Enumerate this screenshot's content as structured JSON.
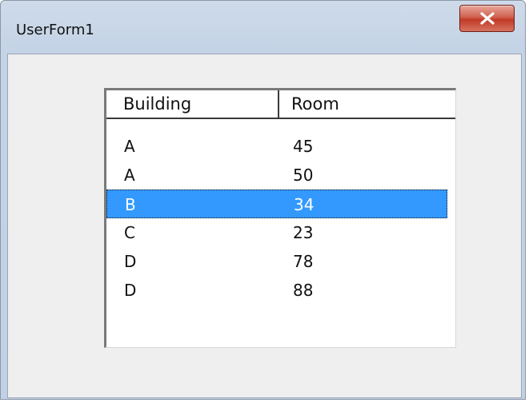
{
  "window": {
    "title": "UserForm1"
  },
  "listbox": {
    "columns": [
      "Building",
      "Room"
    ],
    "rows": [
      {
        "building": "A",
        "room": "45",
        "selected": false
      },
      {
        "building": "A",
        "room": "50",
        "selected": false
      },
      {
        "building": "B",
        "room": "34",
        "selected": true
      },
      {
        "building": "C",
        "room": "23",
        "selected": false
      },
      {
        "building": "D",
        "room": "78",
        "selected": false
      },
      {
        "building": "D",
        "room": "88",
        "selected": false
      }
    ],
    "selection_color": "#3399ff"
  },
  "icons": {
    "close": "close-x-icon"
  }
}
